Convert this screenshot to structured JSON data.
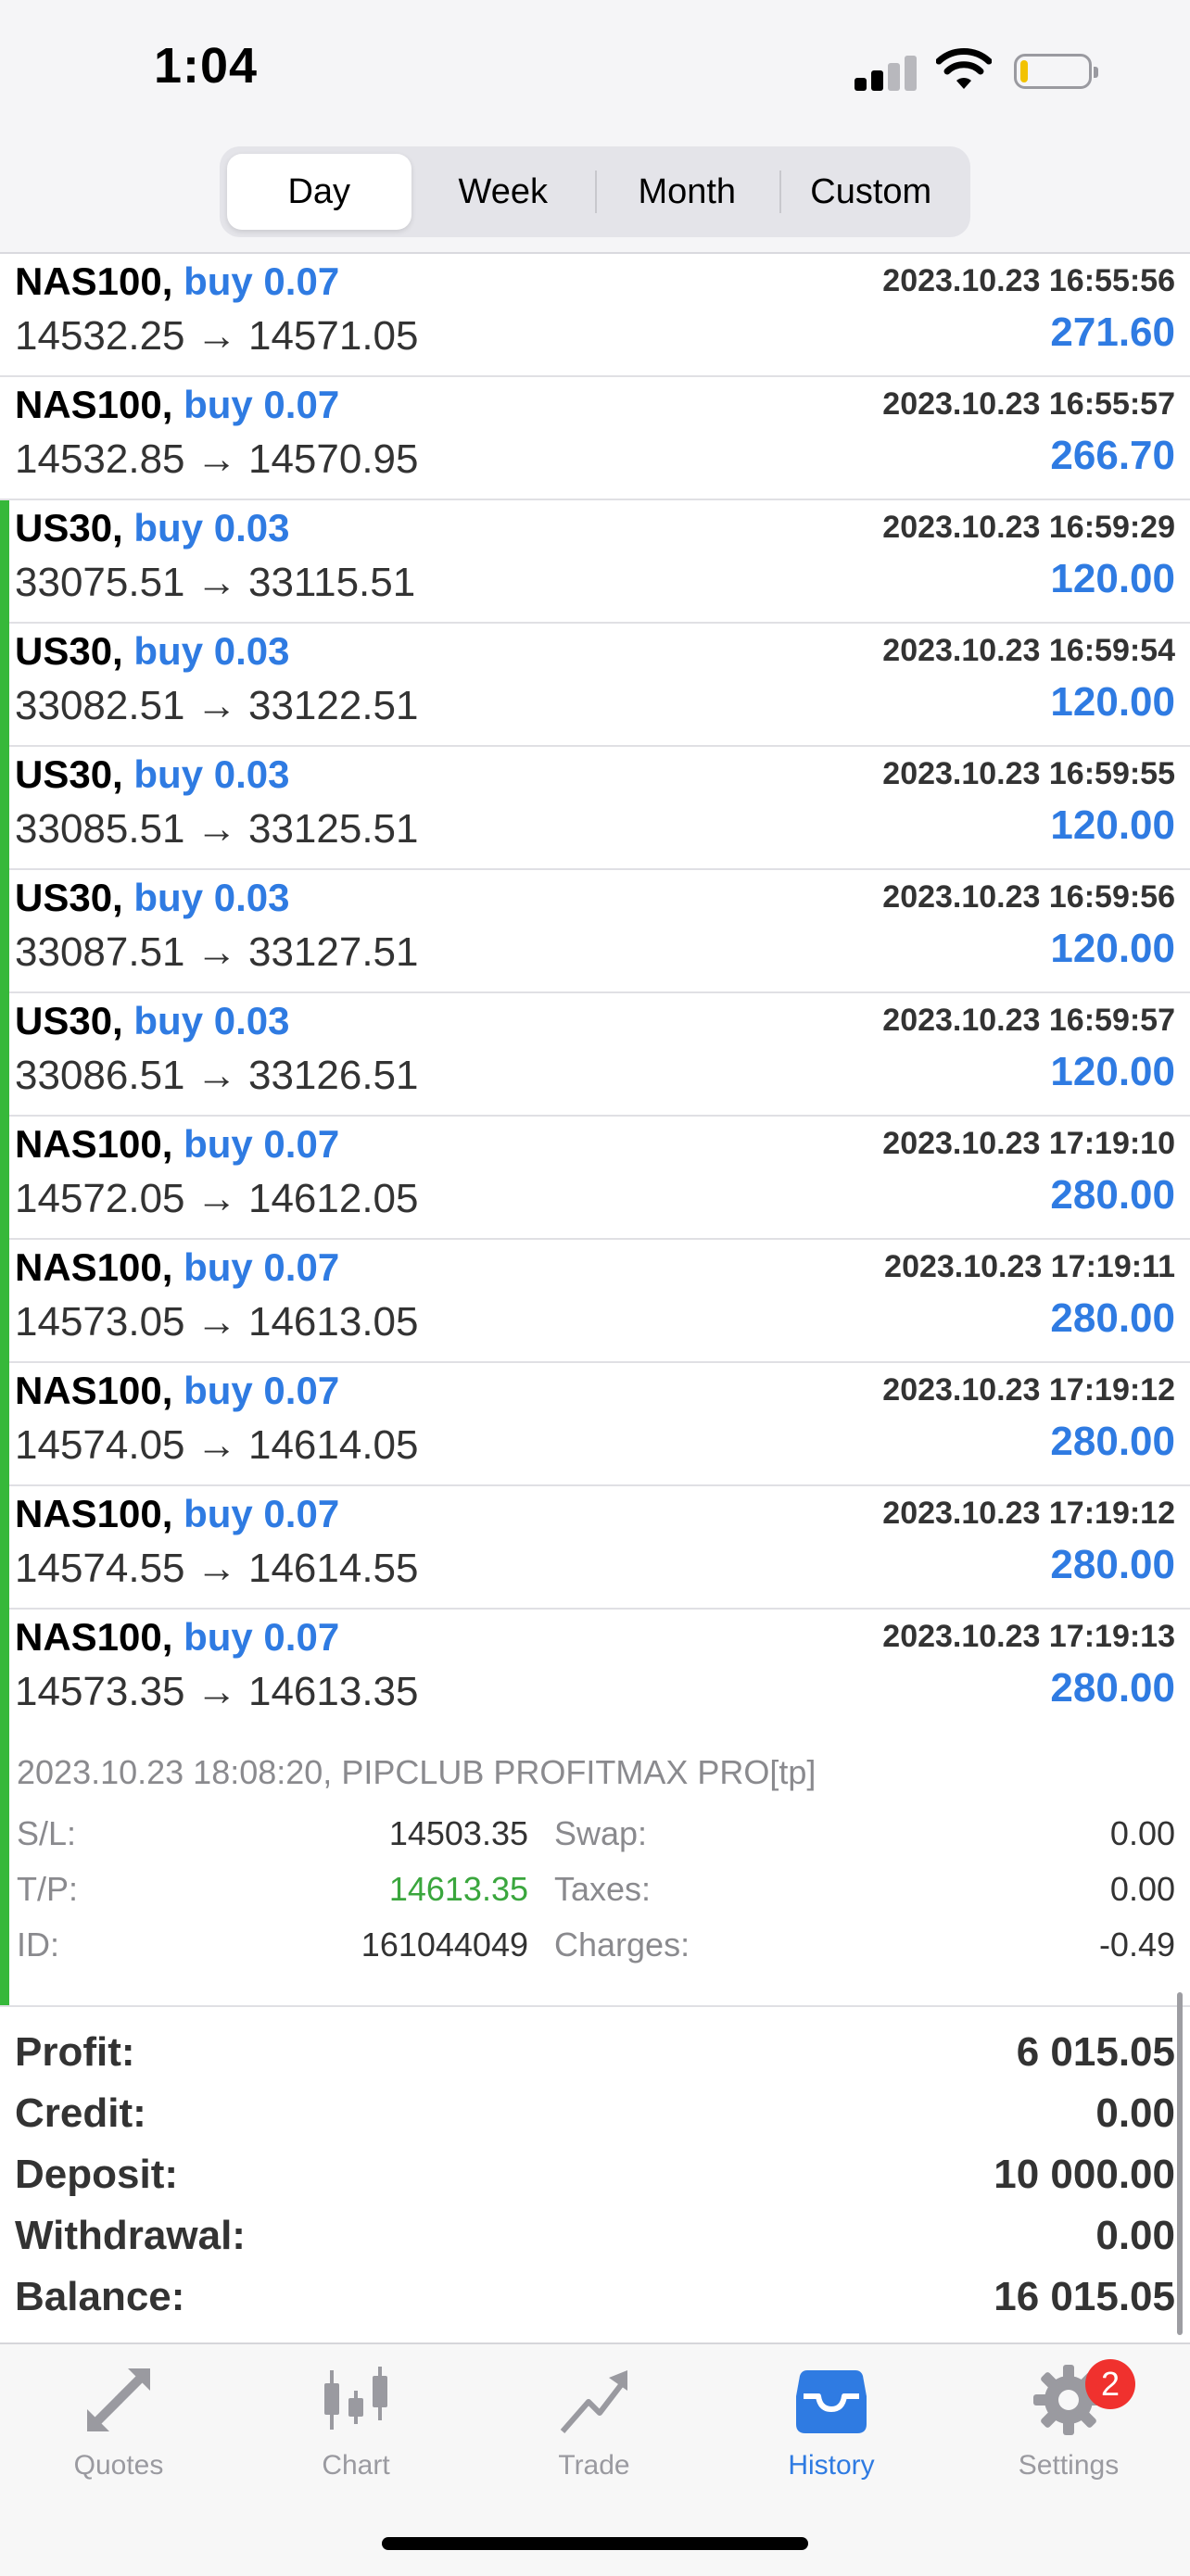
{
  "status_bar": {
    "time": "1:04"
  },
  "segmented": {
    "options": [
      {
        "label": "Day",
        "active": true
      },
      {
        "label": "Week",
        "active": false
      },
      {
        "label": "Month",
        "active": false
      },
      {
        "label": "Custom",
        "active": false
      }
    ]
  },
  "deals": [
    {
      "symbol": "NAS100,",
      "side": "buy 0.07",
      "date": "2023.10.23 16:55:56",
      "prices": "14532.25 → 14571.05",
      "profit": "271.60",
      "marker": false
    },
    {
      "symbol": "NAS100,",
      "side": "buy 0.07",
      "date": "2023.10.23 16:55:57",
      "prices": "14532.85 → 14570.95",
      "profit": "266.70",
      "marker": false
    },
    {
      "symbol": "US30,",
      "side": "buy 0.03",
      "date": "2023.10.23 16:59:29",
      "prices": "33075.51 → 33115.51",
      "profit": "120.00",
      "marker": true
    },
    {
      "symbol": "US30,",
      "side": "buy 0.03",
      "date": "2023.10.23 16:59:54",
      "prices": "33082.51 → 33122.51",
      "profit": "120.00",
      "marker": true
    },
    {
      "symbol": "US30,",
      "side": "buy 0.03",
      "date": "2023.10.23 16:59:55",
      "prices": "33085.51 → 33125.51",
      "profit": "120.00",
      "marker": true
    },
    {
      "symbol": "US30,",
      "side": "buy 0.03",
      "date": "2023.10.23 16:59:56",
      "prices": "33087.51 → 33127.51",
      "profit": "120.00",
      "marker": true
    },
    {
      "symbol": "US30,",
      "side": "buy 0.03",
      "date": "2023.10.23 16:59:57",
      "prices": "33086.51 → 33126.51",
      "profit": "120.00",
      "marker": true
    },
    {
      "symbol": "NAS100,",
      "side": "buy 0.07",
      "date": "2023.10.23 17:19:10",
      "prices": "14572.05 → 14612.05",
      "profit": "280.00",
      "marker": true
    },
    {
      "symbol": "NAS100,",
      "side": "buy 0.07",
      "date": "2023.10.23 17:19:11",
      "prices": "14573.05 → 14613.05",
      "profit": "280.00",
      "marker": true
    },
    {
      "symbol": "NAS100,",
      "side": "buy 0.07",
      "date": "2023.10.23 17:19:12",
      "prices": "14574.05 → 14614.05",
      "profit": "280.00",
      "marker": true
    },
    {
      "symbol": "NAS100,",
      "side": "buy 0.07",
      "date": "2023.10.23 17:19:12",
      "prices": "14574.55 → 14614.55",
      "profit": "280.00",
      "marker": true
    },
    {
      "symbol": "NAS100,",
      "side": "buy 0.07",
      "date": "2023.10.23 17:19:13",
      "prices": "14573.35 → 14613.35",
      "profit": "280.00",
      "marker": true
    }
  ],
  "expanded": {
    "comment": "2023.10.23 18:08:20, PIPCLUB PROFITMAX PRO[tp]",
    "sl_label": "S/L:",
    "sl_value": "14503.35",
    "tp_label": "T/P:",
    "tp_value": "14613.35",
    "id_label": "ID:",
    "id_value": "161044049",
    "swap_label": "Swap:",
    "swap_value": "0.00",
    "taxes_label": "Taxes:",
    "taxes_value": "0.00",
    "charges_label": "Charges:",
    "charges_value": "-0.49"
  },
  "summary": [
    {
      "label": "Profit:",
      "value": "6 015.05"
    },
    {
      "label": "Credit:",
      "value": "0.00"
    },
    {
      "label": "Deposit:",
      "value": "10 000.00"
    },
    {
      "label": "Withdrawal:",
      "value": "0.00"
    },
    {
      "label": "Balance:",
      "value": "16 015.05"
    }
  ],
  "tabbar": {
    "quotes": "Quotes",
    "chart": "Chart",
    "trade": "Trade",
    "history": "History",
    "settings": "Settings",
    "settings_badge": "2"
  },
  "colors": {
    "accent": "#2f7be2",
    "marker_green": "#36b83a",
    "tp_green": "#3aa63d",
    "badge_red": "#f0312e"
  }
}
